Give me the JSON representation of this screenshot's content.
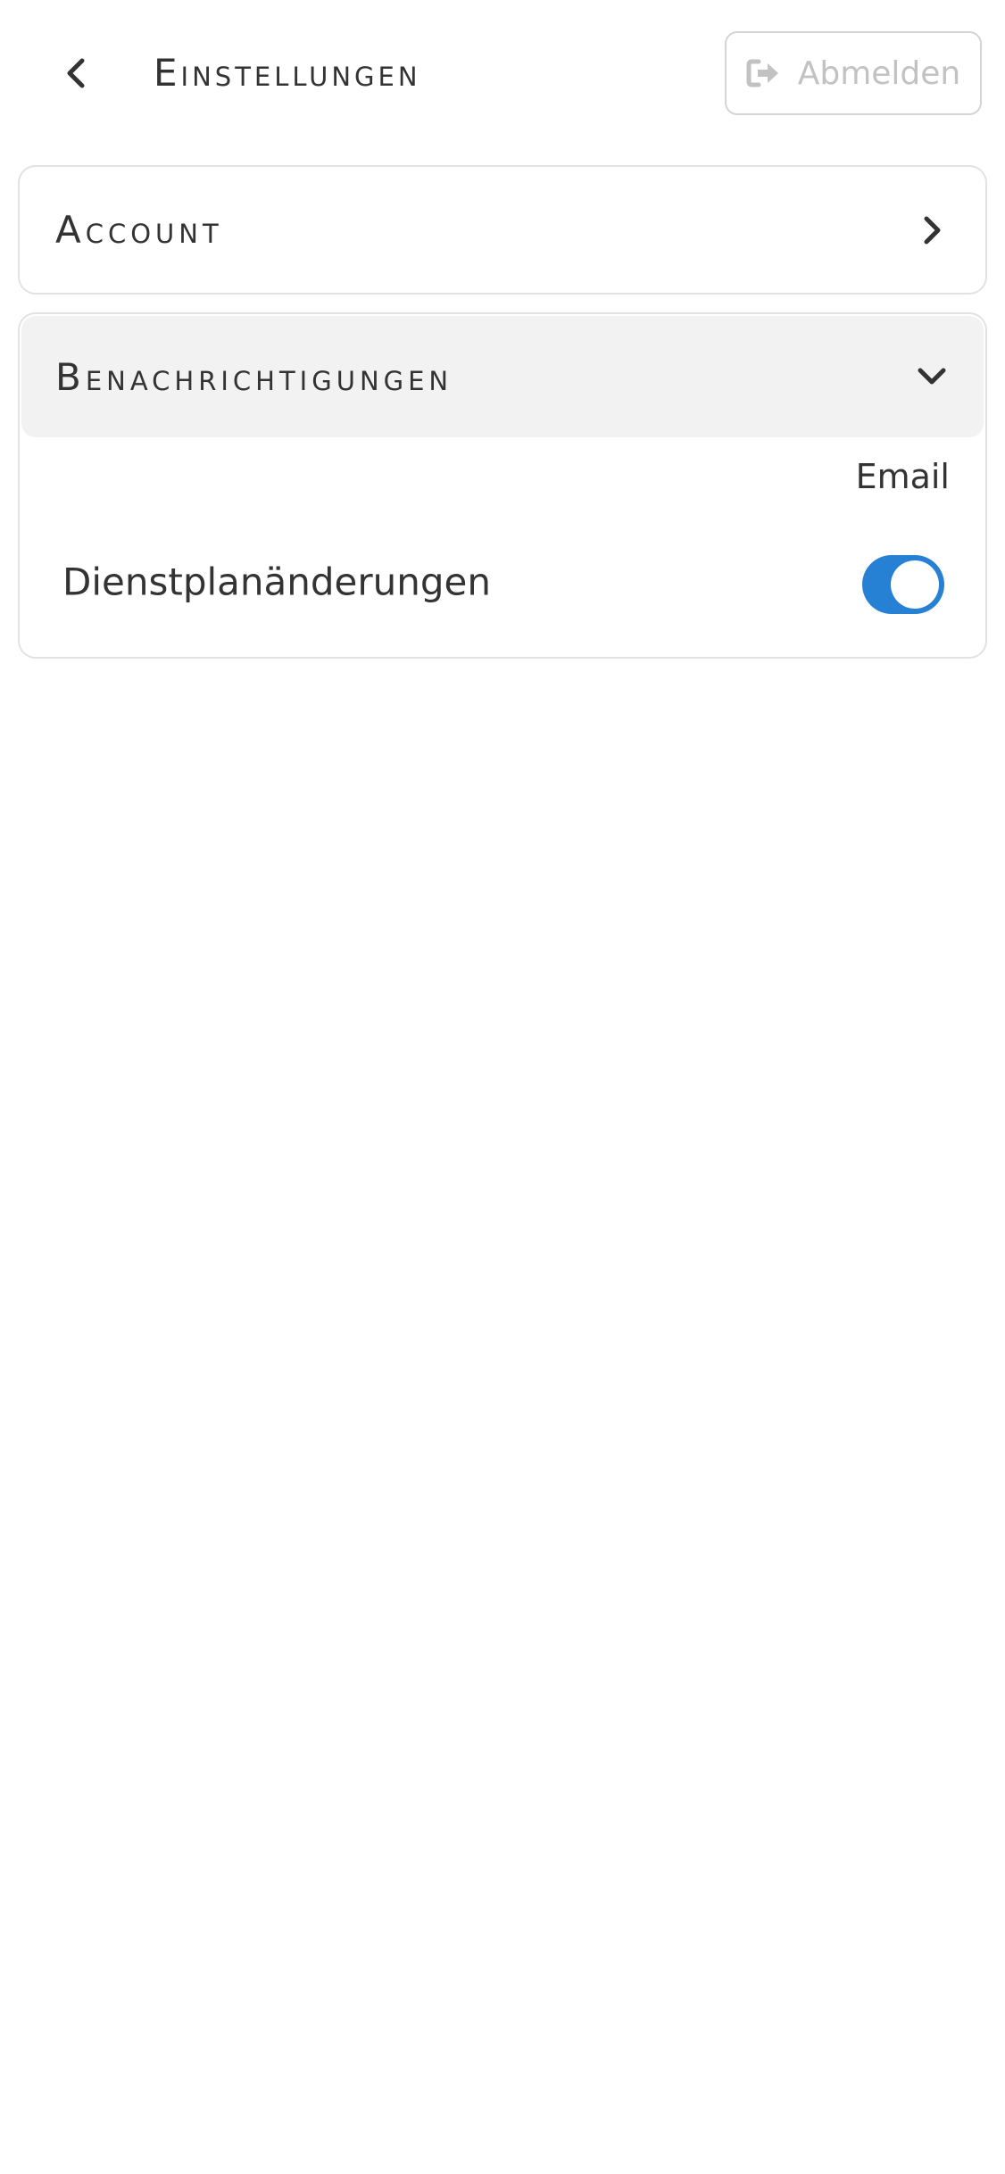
{
  "header": {
    "title": "Einstellungen",
    "back_icon": "chevron-left-icon",
    "logout_label": "Abmelden",
    "logout_icon": "sign-out-icon"
  },
  "sections": [
    {
      "title": "Account",
      "icon": "chevron-right-icon",
      "expanded": false
    },
    {
      "title": "Benachrichtigungen",
      "icon": "chevron-down-icon",
      "expanded": true,
      "column_header": "Email",
      "settings": [
        {
          "label": "Dienstplanänderungen",
          "email_enabled": true
        }
      ]
    }
  ],
  "colors": {
    "accent": "#2680d3",
    "text": "#333333",
    "disabled_text": "#c2c2c2",
    "section_header_bg": "#f2f2f2",
    "border": "#e2e2e2"
  }
}
